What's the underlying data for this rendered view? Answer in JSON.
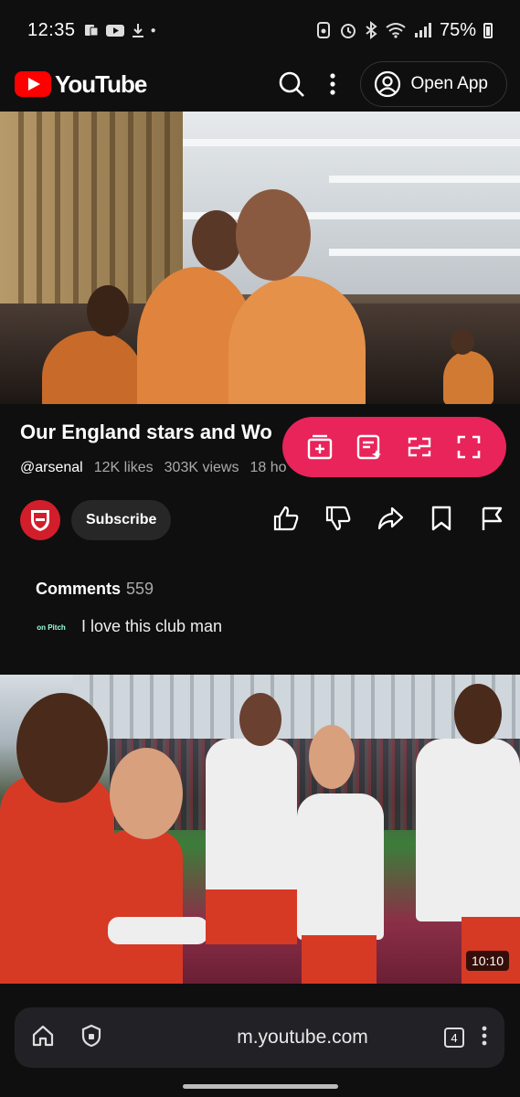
{
  "status_bar": {
    "time": "12:35",
    "battery": "75%",
    "icons_left": [
      "notification-icon",
      "youtube-icon",
      "download-icon",
      "dot"
    ],
    "icons_right": [
      "nfc-icon",
      "alarm-icon",
      "bluetooth-icon",
      "wifi-icon",
      "signal-icon",
      "battery-icon"
    ]
  },
  "header": {
    "logo_text": "YouTube",
    "open_app_label": "Open App"
  },
  "video": {
    "title": "Our England stars and Wo",
    "channel": "@arsenal",
    "likes": "12K likes",
    "views": "303K views",
    "age": "18 ho",
    "subscribe_label": "Subscribe"
  },
  "floating_toolbar": {
    "buttons": [
      "add-to-queue-icon",
      "ai-summary-icon",
      "swap-icon",
      "fullscreen-icon"
    ],
    "color": "#e8245a"
  },
  "comments": {
    "label": "Comments",
    "count": "559",
    "top_comment": "I love this club man",
    "top_comment_avatar": "on Pitch"
  },
  "next_video": {
    "duration": "10:10"
  },
  "browser": {
    "url": "m.youtube.com",
    "tab_count": "4"
  },
  "colors": {
    "youtube_red": "#ff0000",
    "arsenal_red": "#d21e2b",
    "background": "#0f0f0f"
  }
}
